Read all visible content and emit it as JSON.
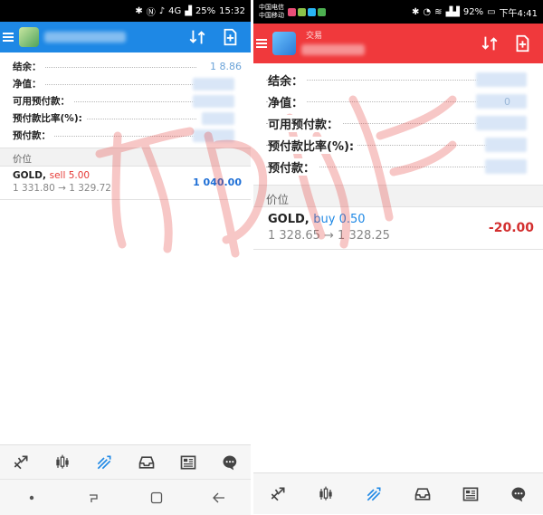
{
  "left_screen": {
    "status": {
      "icons": [
        "bluetooth-icon",
        "nfc-icon",
        "mute-icon",
        "signal-icon"
      ],
      "network_4g": "4G",
      "battery": "25%",
      "time": "15:32"
    },
    "summary": [
      {
        "label": "结余：",
        "value": "1 8.86"
      },
      {
        "label": "净值：",
        "value": ""
      },
      {
        "label": "可用预付款：",
        "value": ""
      },
      {
        "label": "预付款比率(%):",
        "value": ""
      },
      {
        "label": "预付款：",
        "value": ""
      }
    ],
    "section_label": "价位",
    "position": {
      "symbol": "GOLD,",
      "side": "sell 5.00",
      "prices": "1 331.80 → 1 329.72",
      "profit": "1 040.00"
    }
  },
  "right_screen": {
    "status": {
      "carrier_1": "中国电信",
      "carrier_2": "中国移动",
      "battery": "92%",
      "time": "下午4:41"
    },
    "appbar_subtitle": "交易",
    "summary": [
      {
        "label": "结余：",
        "value": ""
      },
      {
        "label": "净值：",
        "value": "0"
      },
      {
        "label": "可用预付款：",
        "value": ""
      },
      {
        "label": "预付款比率(%):",
        "value": ""
      },
      {
        "label": "预付款：",
        "value": ""
      }
    ],
    "section_label": "价位",
    "position": {
      "symbol": "GOLD,",
      "side": "buy 0.50",
      "prices": "1 328.65 → 1 328.25",
      "profit": "-20.00"
    }
  },
  "colors": {
    "left_bar": "#1e88e5",
    "right_bar": "#f0393c",
    "profit_positive": "#1e6fd6",
    "profit_negative": "#d32f2f",
    "sell": "#e53935",
    "buy": "#1e88e5"
  },
  "bottom_nav": [
    "quotes-icon",
    "chart-icon",
    "trade-icon",
    "history-icon",
    "news-icon",
    "chat-icon"
  ]
}
